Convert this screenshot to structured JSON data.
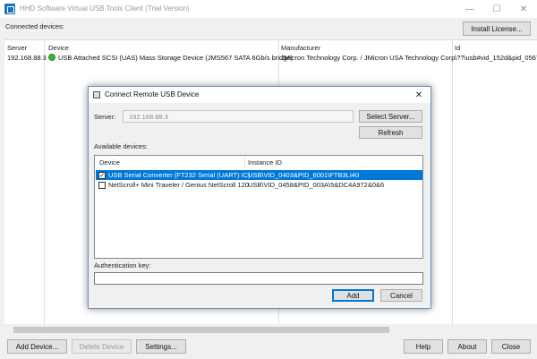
{
  "window": {
    "title": "HHD Software Virtual USB Tools Client (Trial Version)",
    "minimize_glyph": "—",
    "maximize_glyph": "☐",
    "close_glyph": "✕"
  },
  "main": {
    "connected_label": "Connected devices:",
    "install_license_label": "Install License...",
    "columns": [
      "Server",
      "Device",
      "Manufacturer",
      "Id"
    ],
    "rows": [
      {
        "server": "192.168.88.3",
        "device": "USB Attached SCSI (UAS) Mass Storage Device (JMS567 SATA 6Gb/s bridge)",
        "manufacturer": "JMicron Technology Corp. / JMicron USA Technology Corp.",
        "id": "\\??\\usb#vid_152d&pid_0567",
        "status_color": "#3bb534"
      }
    ]
  },
  "toolbar": {
    "add_device": "Add Device...",
    "delete_device": "Delete Device",
    "settings": "Settings...",
    "help": "Help",
    "about": "About",
    "close": "Close"
  },
  "dialog": {
    "title": "Connect Remote USB Device",
    "close_glyph": "✕",
    "server_label": "Server:",
    "server_value": "192.168.88.3",
    "select_server": "Select Server...",
    "refresh": "Refresh",
    "available_label": "Available devices:",
    "columns": [
      "Device",
      "Instance ID"
    ],
    "devices": [
      {
        "checked": true,
        "check_glyph": "✓",
        "name": "USB Serial Converter (FT232 Serial (UART) IC)",
        "instance_id": "USB\\VID_0403&PID_6001\\FTB3LI40",
        "selected": true
      },
      {
        "checked": false,
        "check_glyph": "",
        "name": "NetScroll+ Mini Traveler / Genius NetScroll 120",
        "instance_id": "USB\\VID_0458&PID_003A\\5&DC4A972&0&6",
        "selected": false
      }
    ],
    "auth_label": "Authentication key:",
    "auth_value": "",
    "add": "Add",
    "cancel": "Cancel"
  },
  "colors": {
    "selection": "#0078d7",
    "window_bg": "#f0f0f0",
    "status_ok": "#3bb534"
  }
}
